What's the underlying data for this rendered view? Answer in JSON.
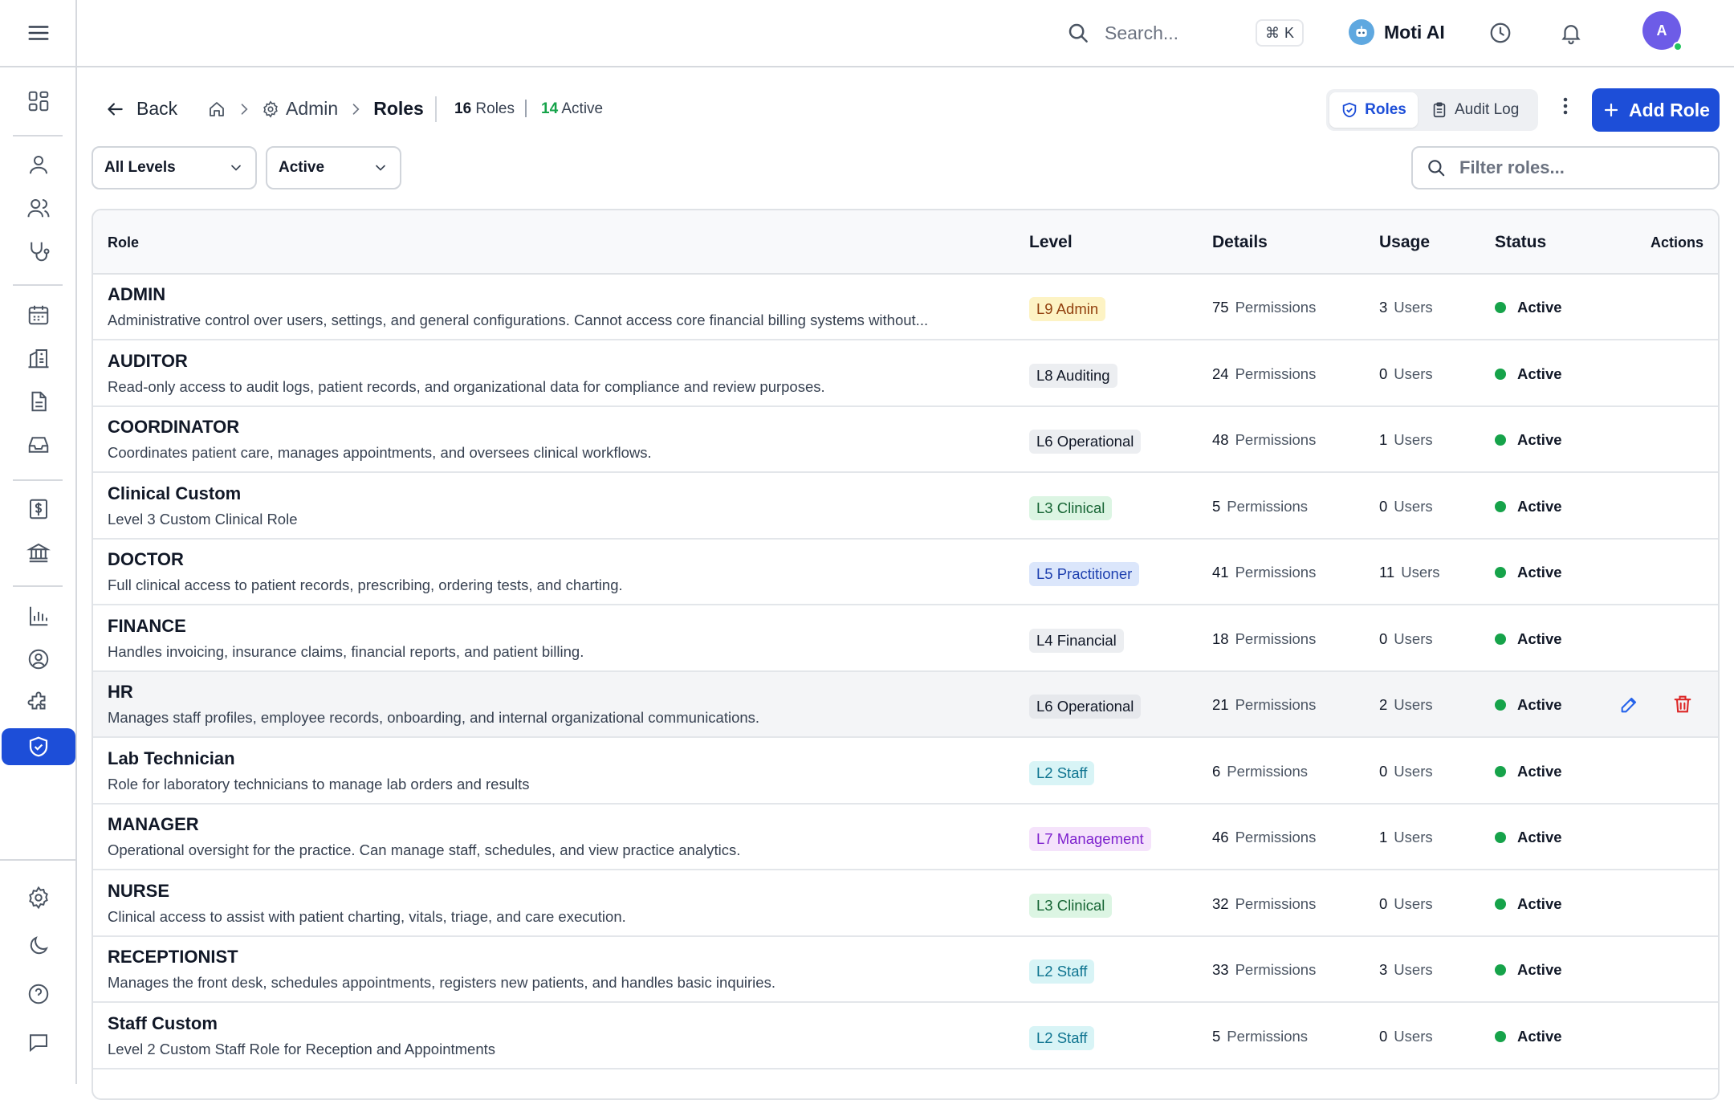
{
  "topbar": {
    "search_placeholder": "Search...",
    "shortcut_symbol": "⌘",
    "shortcut_key": "K",
    "ai_label": "Moti AI",
    "avatar_initial": "A"
  },
  "header": {
    "back_label": "Back",
    "breadcrumb_admin": "Admin",
    "breadcrumb_current": "Roles",
    "roles_count": "16",
    "roles_label": "Roles",
    "active_count": "14",
    "active_label": "Active",
    "tab_roles": "Roles",
    "tab_audit": "Audit Log",
    "add_role_label": "Add Role"
  },
  "filters": {
    "level_value": "All Levels",
    "status_value": "Active",
    "filter_placeholder": "Filter roles..."
  },
  "table": {
    "columns": {
      "role": "Role",
      "level": "Level",
      "details": "Details",
      "usage": "Usage",
      "status": "Status",
      "actions": "Actions"
    },
    "rows": [
      {
        "name": "ADMIN",
        "desc": "Administrative control over users, settings, and general configurations. Cannot access core financial billing systems without...",
        "level": "L9 Admin",
        "level_color": "#fdf3c4",
        "level_text": "#92400e",
        "perms": "75",
        "perm_unit": "Permissions",
        "users": "3",
        "user_unit": "Users",
        "status": "Active"
      },
      {
        "name": "AUDITOR",
        "desc": "Read-only access to audit logs, patient records, and organizational data for compliance and review purposes.",
        "level": "L8 Auditing",
        "level_color": "#eceef1",
        "level_text": "#111827",
        "perms": "24",
        "perm_unit": "Permissions",
        "users": "0",
        "user_unit": "Users",
        "status": "Active"
      },
      {
        "name": "COORDINATOR",
        "desc": "Coordinates patient care, manages appointments, and oversees clinical workflows.",
        "level": "L6 Operational",
        "level_color": "#eceef1",
        "level_text": "#111827",
        "perms": "48",
        "perm_unit": "Permissions",
        "users": "1",
        "user_unit": "Users",
        "status": "Active"
      },
      {
        "name": "Clinical Custom",
        "desc": "Level 3 Custom Clinical Role",
        "level": "L3 Clinical",
        "level_color": "#dcf5e3",
        "level_text": "#166534",
        "perms": "5",
        "perm_unit": "Permissions",
        "users": "0",
        "user_unit": "Users",
        "status": "Active"
      },
      {
        "name": "DOCTOR",
        "desc": "Full clinical access to patient records, prescribing, ordering tests, and charting.",
        "level": "L5 Practitioner",
        "level_color": "#dbe6fb",
        "level_text": "#1e40af",
        "perms": "41",
        "perm_unit": "Permissions",
        "users": "11",
        "user_unit": "Users",
        "status": "Active"
      },
      {
        "name": "FINANCE",
        "desc": "Handles invoicing, insurance claims, financial reports, and patient billing.",
        "level": "L4 Financial",
        "level_color": "#eceef1",
        "level_text": "#111827",
        "perms": "18",
        "perm_unit": "Permissions",
        "users": "0",
        "user_unit": "Users",
        "status": "Active"
      },
      {
        "name": "HR",
        "desc": "Manages staff profiles, employee records, onboarding, and internal organizational communications.",
        "level": "L6 Operational",
        "level_color": "#e6e8ec",
        "level_text": "#111827",
        "perms": "21",
        "perm_unit": "Permissions",
        "users": "2",
        "user_unit": "Users",
        "status": "Active",
        "hover": true
      },
      {
        "name": "Lab Technician",
        "desc": "Role for laboratory technicians to manage lab orders and results",
        "level": "L2 Staff",
        "level_color": "#d8f4f6",
        "level_text": "#0e7490",
        "perms": "6",
        "perm_unit": "Permissions",
        "users": "0",
        "user_unit": "Users",
        "status": "Active"
      },
      {
        "name": "MANAGER",
        "desc": "Operational oversight for the practice. Can manage staff, schedules, and view practice analytics.",
        "level": "L7 Management",
        "level_color": "#f5e3fb",
        "level_text": "#7e22ce",
        "perms": "46",
        "perm_unit": "Permissions",
        "users": "1",
        "user_unit": "Users",
        "status": "Active"
      },
      {
        "name": "NURSE",
        "desc": "Clinical access to assist with patient charting, vitals, triage, and care execution.",
        "level": "L3 Clinical",
        "level_color": "#dcf5e3",
        "level_text": "#166534",
        "perms": "32",
        "perm_unit": "Permissions",
        "users": "0",
        "user_unit": "Users",
        "status": "Active"
      },
      {
        "name": "RECEPTIONIST",
        "desc": "Manages the front desk, schedules appointments, registers new patients, and handles basic inquiries.",
        "level": "L2 Staff",
        "level_color": "#d8f4f6",
        "level_text": "#0e7490",
        "perms": "33",
        "perm_unit": "Permissions",
        "users": "3",
        "user_unit": "Users",
        "status": "Active"
      },
      {
        "name": "Staff Custom",
        "desc": "Level 2 Custom Staff Role for Reception and Appointments",
        "level": "L2 Staff",
        "level_color": "#d8f4f6",
        "level_text": "#0e7490",
        "perms": "5",
        "perm_unit": "Permissions",
        "users": "0",
        "user_unit": "Users",
        "status": "Active"
      }
    ]
  },
  "colors": {
    "accent": "#1d4ed8",
    "active_green": "#16a34a",
    "delete_red": "#dc2626"
  }
}
